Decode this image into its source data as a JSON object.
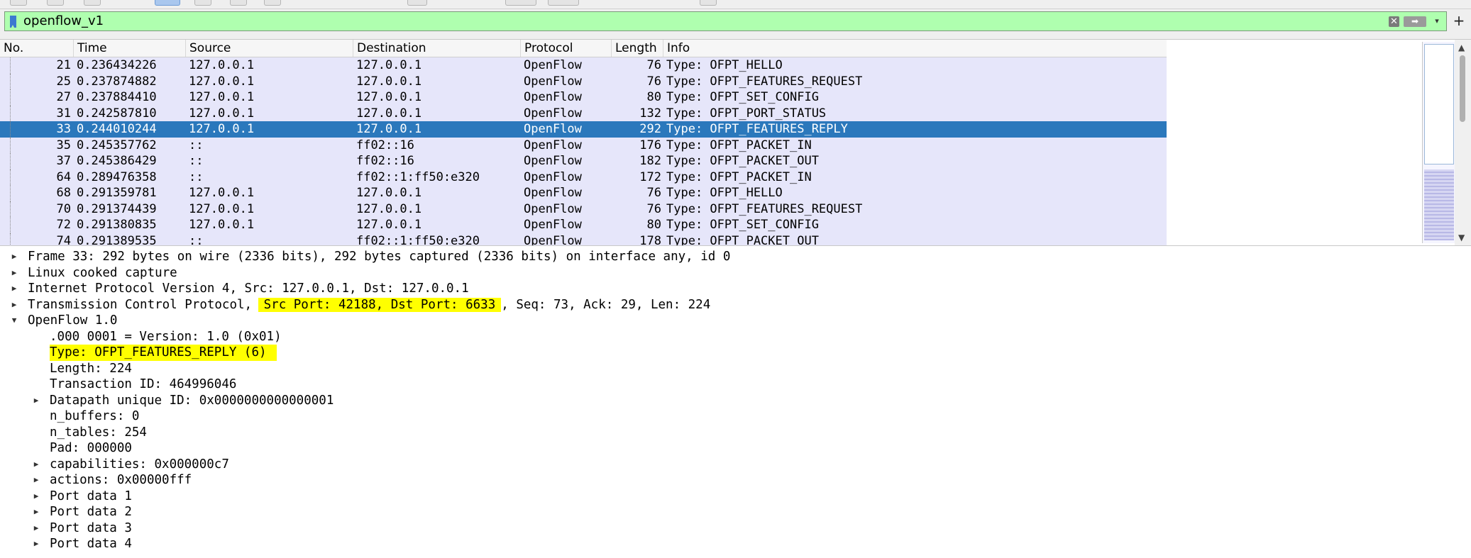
{
  "filter": {
    "value": "openflow_v1"
  },
  "packet_list": {
    "columns": [
      "No.",
      "Time",
      "Source",
      "Destination",
      "Protocol",
      "Length",
      "Info"
    ],
    "rows": [
      {
        "no": "21",
        "time": "0.236434226",
        "src": "127.0.0.1",
        "dst": "127.0.0.1",
        "proto": "OpenFlow",
        "len": "76",
        "info": "Type: OFPT_HELLO"
      },
      {
        "no": "25",
        "time": "0.237874882",
        "src": "127.0.0.1",
        "dst": "127.0.0.1",
        "proto": "OpenFlow",
        "len": "76",
        "info": "Type: OFPT_FEATURES_REQUEST"
      },
      {
        "no": "27",
        "time": "0.237884410",
        "src": "127.0.0.1",
        "dst": "127.0.0.1",
        "proto": "OpenFlow",
        "len": "80",
        "info": "Type: OFPT_SET_CONFIG"
      },
      {
        "no": "31",
        "time": "0.242587810",
        "src": "127.0.0.1",
        "dst": "127.0.0.1",
        "proto": "OpenFlow",
        "len": "132",
        "info": "Type: OFPT_PORT_STATUS"
      },
      {
        "no": "33",
        "time": "0.244010244",
        "src": "127.0.0.1",
        "dst": "127.0.0.1",
        "proto": "OpenFlow",
        "len": "292",
        "info": "Type: OFPT_FEATURES_REPLY",
        "selected": true
      },
      {
        "no": "35",
        "time": "0.245357762",
        "src": "::",
        "dst": "ff02::16",
        "proto": "OpenFlow",
        "len": "176",
        "info": "Type: OFPT_PACKET_IN"
      },
      {
        "no": "37",
        "time": "0.245386429",
        "src": "::",
        "dst": "ff02::16",
        "proto": "OpenFlow",
        "len": "182",
        "info": "Type: OFPT_PACKET_OUT"
      },
      {
        "no": "64",
        "time": "0.289476358",
        "src": "::",
        "dst": "ff02::1:ff50:e320",
        "proto": "OpenFlow",
        "len": "172",
        "info": "Type: OFPT_PACKET_IN"
      },
      {
        "no": "68",
        "time": "0.291359781",
        "src": "127.0.0.1",
        "dst": "127.0.0.1",
        "proto": "OpenFlow",
        "len": "76",
        "info": "Type: OFPT_HELLO"
      },
      {
        "no": "70",
        "time": "0.291374439",
        "src": "127.0.0.1",
        "dst": "127.0.0.1",
        "proto": "OpenFlow",
        "len": "76",
        "info": "Type: OFPT_FEATURES_REQUEST"
      },
      {
        "no": "72",
        "time": "0.291380835",
        "src": "127.0.0.1",
        "dst": "127.0.0.1",
        "proto": "OpenFlow",
        "len": "80",
        "info": "Type: OFPT_SET_CONFIG"
      },
      {
        "no": "74",
        "time": "0.291389535",
        "src": "::",
        "dst": "ff02::1:ff50:e320",
        "proto": "OpenFlow",
        "len": "178",
        "info": "Type: OFPT_PACKET_OUT"
      }
    ]
  },
  "details": {
    "frame": "Frame 33: 292 bytes on wire (2336 bits), 292 bytes captured (2336 bits) on interface any, id 0",
    "linux": "Linux cooked capture",
    "ipv4": "Internet Protocol Version 4, Src: 127.0.0.1, Dst: 127.0.0.1",
    "tcp_prefix": "Transmission Control Protocol, ",
    "tcp_ports": "Src Port: 42188, Dst Port: 6633",
    "tcp_suffix": ", Seq: 73, Ack: 29, Len: 224",
    "openflow": "OpenFlow 1.0",
    "version": ".000 0001 = Version: 1.0 (0x01)",
    "type": "Type: OFPT_FEATURES_REPLY (6)",
    "length": "Length: 224",
    "xid": "Transaction ID: 464996046",
    "datapath": "Datapath unique ID: 0x0000000000000001",
    "n_buffers": "n_buffers: 0",
    "n_tables": "n_tables: 254",
    "pad": "Pad: 000000",
    "capabilities": "capabilities: 0x000000c7",
    "actions": "actions: 0x00000fff",
    "port1": "Port data 1",
    "port2": "Port data 2",
    "port3": "Port data 3",
    "port4": "Port data 4"
  },
  "colors": {
    "filter_valid_bg": "#afffaf",
    "row_bg": "#e6e6fa",
    "selected_row_bg": "#2b78bc",
    "highlight": "#ffff00"
  },
  "icons": {
    "bookmark": "bookmark-icon",
    "clear": "clear-icon",
    "apply": "apply-arrow-icon",
    "dropdown": "chevron-down-icon",
    "add": "plus-icon",
    "collapsed": "triangle-right-icon",
    "expanded": "triangle-down-icon"
  }
}
